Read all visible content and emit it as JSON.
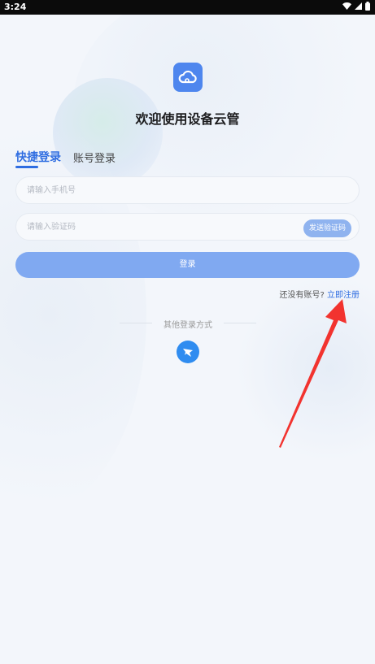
{
  "status_bar": {
    "time": "3:24"
  },
  "brand": {
    "welcome_title": "欢迎使用设备云管",
    "logo_icon": "cloud-icon",
    "accent_color": "#2f6de1"
  },
  "tabs": [
    {
      "label": "快捷登录",
      "active": true
    },
    {
      "label": "账号登录",
      "active": false
    }
  ],
  "form": {
    "phone_placeholder": "请输入手机号",
    "code_placeholder": "请输入验证码",
    "send_code_label": "发送验证码",
    "login_label": "登录"
  },
  "register": {
    "prompt": "还没有账号?",
    "link_label": "立即注册"
  },
  "other_login": {
    "label": "其他登录方式",
    "icon": "dingtalk-icon"
  }
}
